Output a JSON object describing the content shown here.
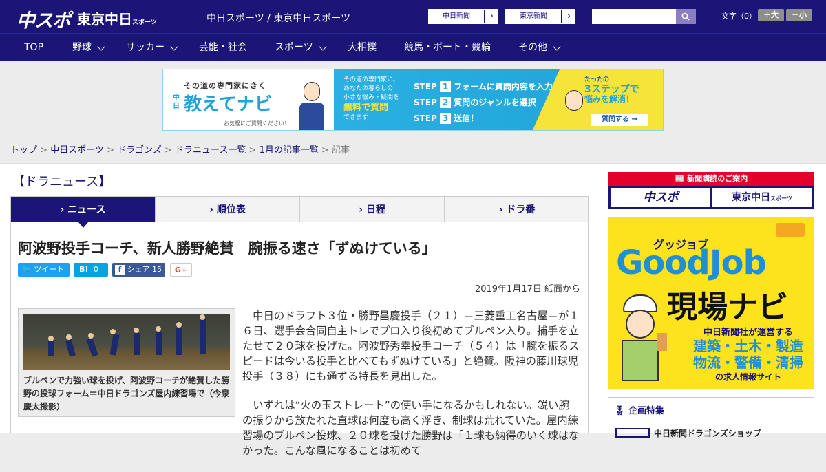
{
  "header": {
    "logo_chusupo": "中スポ",
    "logo_tokyo": "東京中日",
    "logo_tokyo_sub": "スポーツ",
    "site_name": "中日スポーツ / 東京中日スポーツ",
    "btn_chunichi": "中日新聞",
    "btn_tokyo": "東京新聞",
    "search_placeholder": "",
    "font_label": "文字（0）",
    "font_plus": "＋大",
    "font_minus": "－小"
  },
  "nav": [
    {
      "label": "TOP"
    },
    {
      "label": "野球"
    },
    {
      "label": "サッカー"
    },
    {
      "label": "芸能・社会"
    },
    {
      "label": "スポーツ"
    },
    {
      "label": "大相撲"
    },
    {
      "label": "競馬・ボート・競輪"
    },
    {
      "label": "その他"
    }
  ],
  "ad": {
    "tag": "その道の専門家にきく",
    "brand_small": "中日",
    "brand": "教えてナビ",
    "note": "お気軽にご質問ください！",
    "mid_text1": "その道の専門家に、",
    "mid_text2": "あなたの暮らしの",
    "mid_text3": "小さな悩み・疑問を",
    "mid_highlight": "無料で質問",
    "mid_text4": "できます",
    "step_word": "STEP",
    "step1": "フォームに質問内容を入力",
    "step2": "質問のジャンルを選択",
    "step3": "送信！",
    "right1": "たったの",
    "right2": "3ステップで",
    "right3": "悩みを解消！",
    "cta": "質問する →"
  },
  "breadcrumb": {
    "items": [
      "トップ",
      "中日スポーツ",
      "ドラゴンズ",
      "ドラニュース一覧",
      "1月の記事一覧"
    ],
    "current": "記事",
    "sep": " > "
  },
  "section_title": "【ドラニュース】",
  "tabs": [
    {
      "label": "ニュース"
    },
    {
      "label": "順位表"
    },
    {
      "label": "日程"
    },
    {
      "label": "ドラ番"
    }
  ],
  "article": {
    "headline": "阿波野投手コーチ、新人勝野絶賛　腕振る速さ「ずぬけている」",
    "share": {
      "tweet": "ツイート",
      "hatena_count": "0",
      "fb_label": "シェア",
      "fb_count": "15",
      "gplus": "G+"
    },
    "date": "2019年1月17日 紙面から",
    "caption": "ブルペンで力強い球を投げ、阿波野コーチが絶賛した勝野の投球フォーム＝中日ドラゴンズ屋内練習場で（今泉慶太撮影）",
    "paragraphs": [
      "中日のドラフト３位・勝野昌慶投手（２１）＝三菱重工名古屋＝が１６日、選手会合同自主トレでプロ入り後初めてブルペン入り。捕手を立たせて２０球を投げた。阿波野秀幸投手コーチ（５４）は「腕を振るスピードは今いる投手と比べてもずぬけている」と絶賛。阪神の藤川球児投手（３８）にも通ずる特長を見出した。",
      "いずれは“火の玉ストレート”の使い手になるかもしれない。鋭い腕の振りから放たれた直球は何度も高く浮き、制球は荒れていた。屋内練習場のブルペン投球、２０球を投げた勝野は「１球も納得のいく球はなかった。こんな風になることは初めて"
    ]
  },
  "sidebar": {
    "subscribe_header": "新聞購読のご案内",
    "sub_logo1": "中スポ",
    "sub_logo2": "東京中日",
    "sub_logo2_small": "スポーツ",
    "gj_kana": "グッジョブ",
    "gj_title": "GoodJob",
    "gj_sub": "現場ナビ",
    "gj_desc1": "中日新聞社が運営する",
    "gj_desc2": "建築・土木・製造",
    "gj_desc3": "物流・警備・清掃",
    "gj_desc4": "の求人情報サイト",
    "feature_title": "企画特集",
    "feature_item": "中日新聞ドラゴンズショップ"
  },
  "colors": {
    "brand": "#1a1577",
    "accent_red": "#e3002b",
    "ad_blue": "#2bb0e3",
    "ad_yellow": "#f7e43a",
    "goodjob_yellow": "#fce31c"
  }
}
